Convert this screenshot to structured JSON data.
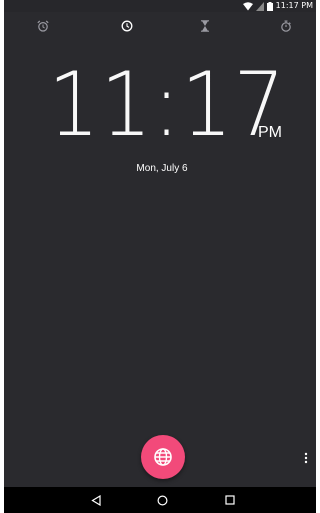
{
  "status_bar": {
    "time": "11:17 PM",
    "icons": [
      "wifi-icon",
      "signal-icon",
      "battery-icon"
    ]
  },
  "tabs": [
    {
      "name": "alarm",
      "icon": "alarm-clock-icon"
    },
    {
      "name": "clock",
      "icon": "clock-icon",
      "selected": true
    },
    {
      "name": "timer",
      "icon": "hourglass-icon"
    },
    {
      "name": "stopwatch",
      "icon": "stopwatch-icon"
    }
  ],
  "clock": {
    "time": "11:17",
    "ampm": "PM",
    "date": "Mon, July 6"
  },
  "fab": {
    "icon": "globe-icon"
  },
  "overflow": {
    "icon": "more-vertical-icon"
  },
  "nav": {
    "icons": [
      "back-icon",
      "home-icon",
      "recents-icon"
    ]
  },
  "colors": {
    "background": "#2a2a2e",
    "accent": "#f24a7a",
    "navbar": "#000000",
    "text": "#ffffff"
  }
}
